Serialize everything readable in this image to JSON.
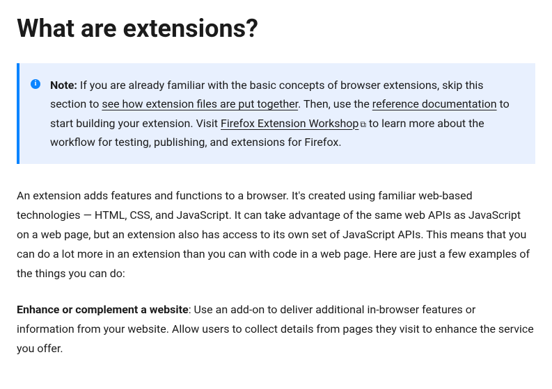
{
  "title": "What are extensions?",
  "note": {
    "label": "Note:",
    "text_before_link1": " If you are already familiar with the basic concepts of browser extensions, skip this section to ",
    "link1": "see how extension files are put together",
    "text_after_link1": ". Then, use the ",
    "link2": "reference documentation",
    "text_after_link2": " to start building your extension. Visit ",
    "link3": "Firefox Extension Workshop",
    "text_after_link3": " to learn more about the workflow for testing, publishing, and extensions for Firefox."
  },
  "para1": "An extension adds features and functions to a browser. It's created using familiar web-based technologies — HTML, CSS, and JavaScript. It can take advantage of the same web APIs as JavaScript on a web page, but an extension also has access to its own set of JavaScript APIs. This means that you can do a lot more in an extension than you can with code in a web page. Here are just a few examples of the things you can do:",
  "para2": {
    "bold": "Enhance or complement a website",
    "rest": ": Use an add-on to deliver additional in-browser features or information from your website. Allow users to collect details from pages they visit to enhance the service you offer."
  }
}
